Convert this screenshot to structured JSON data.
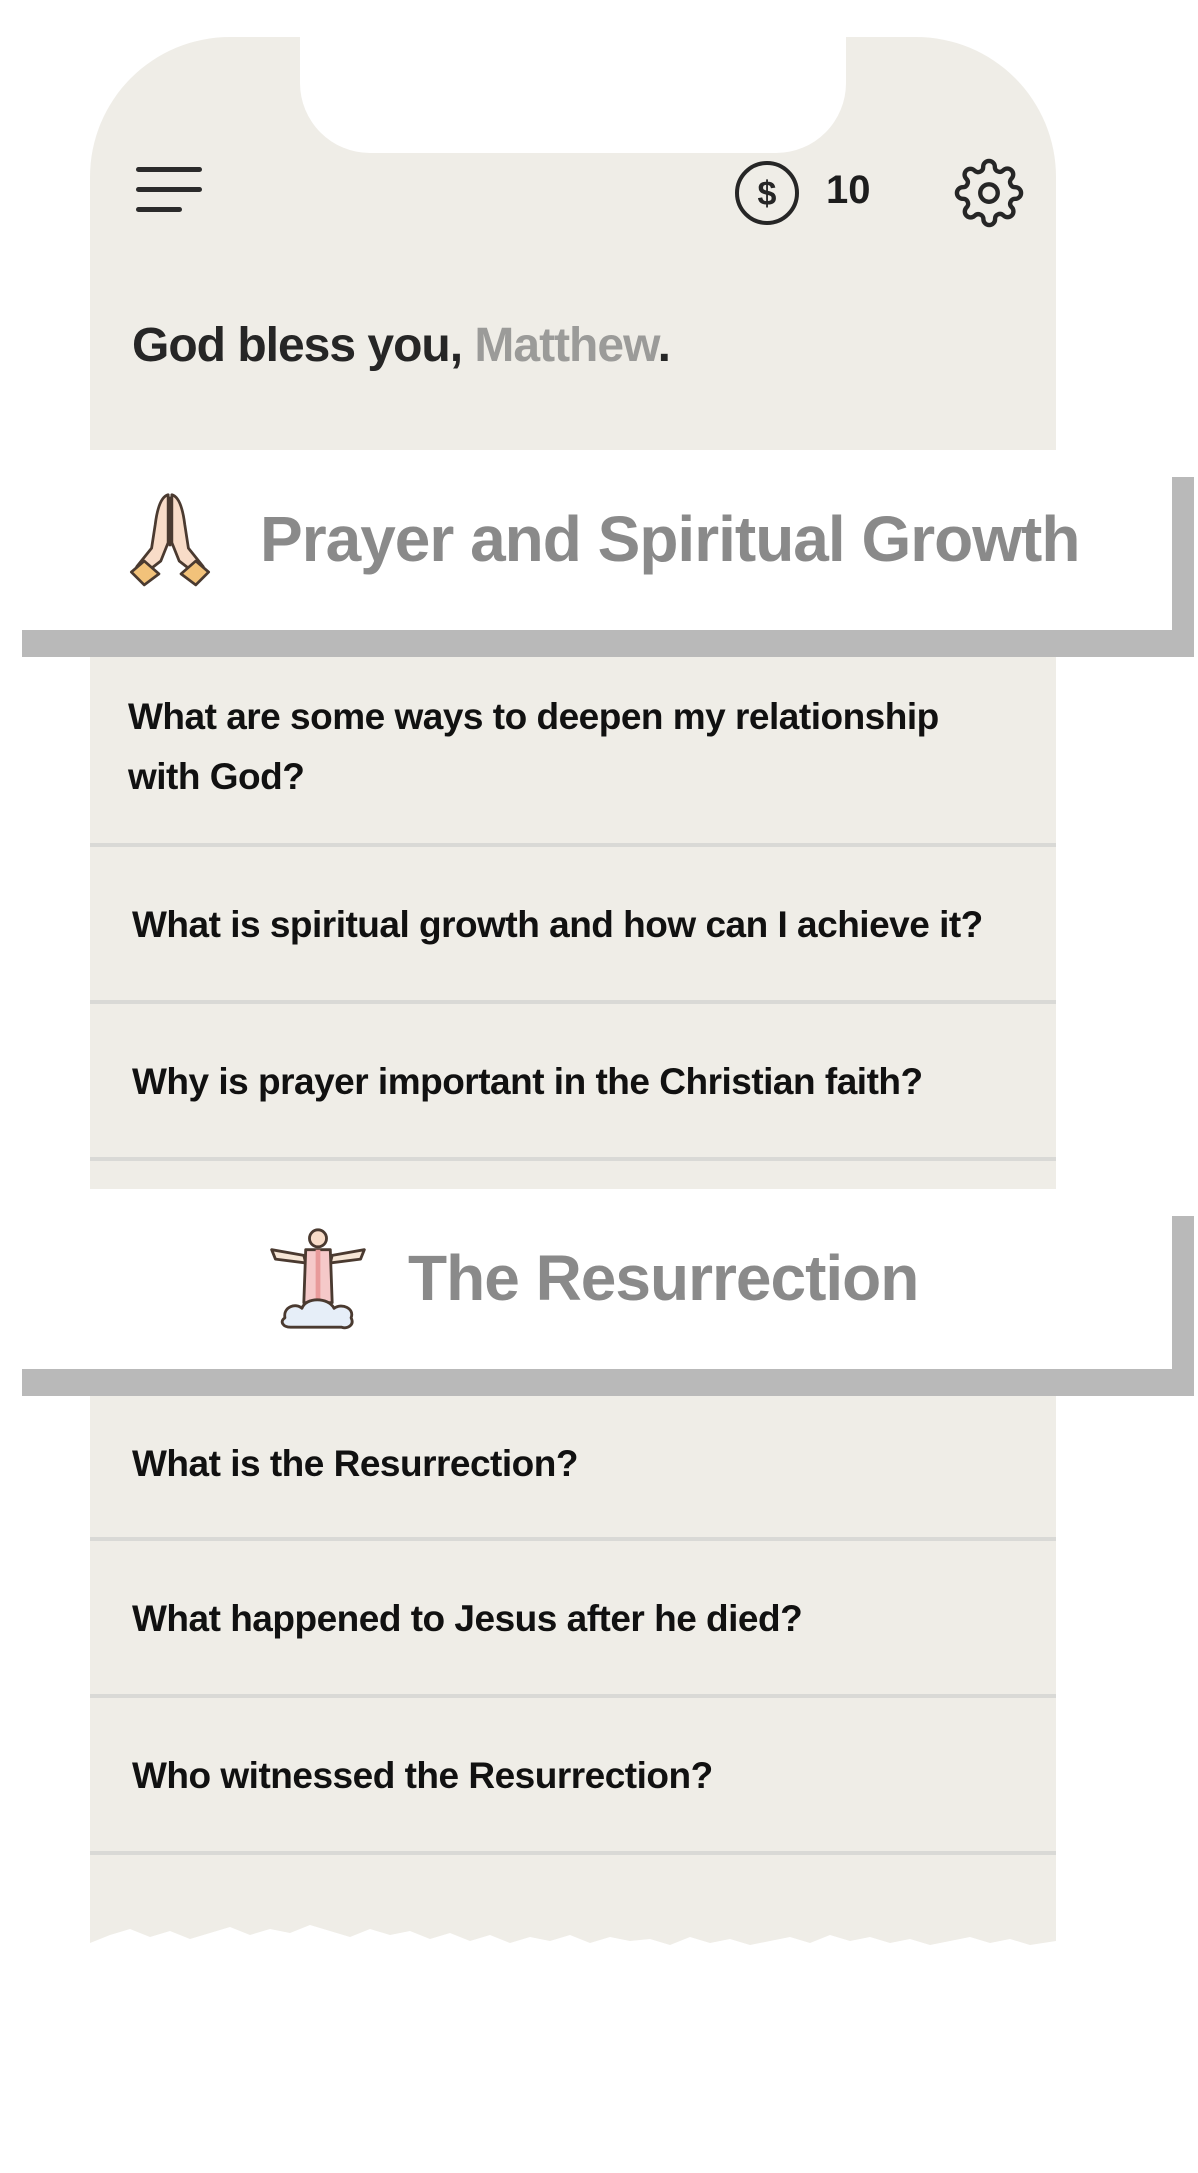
{
  "header": {
    "coin_count": "10",
    "greeting_prefix": "God bless you, ",
    "greeting_name": "Matthew",
    "greeting_suffix": "."
  },
  "icons": {
    "menu": "hamburger-menu-icon",
    "coin": "dollar-coin-icon",
    "settings": "gear-icon",
    "prayer": "praying-hands-icon",
    "resurrection": "christ-statue-icon"
  },
  "sections": [
    {
      "title": "Prayer and Spiritual Growth",
      "questions": [
        "What are some ways to deepen my relationship with God?",
        "What is spiritual growth and how can I achieve it?",
        "Why is prayer important in the Christian faith?"
      ]
    },
    {
      "title": "The Resurrection",
      "questions": [
        "What is the Resurrection?",
        "What happened to Jesus after he died?",
        "Who witnessed the Resurrection?"
      ]
    }
  ],
  "colors": {
    "background": "#efede7",
    "text": "#111111",
    "muted": "#8a8a8a",
    "divider": "#d9d9d6",
    "card": "#ffffff",
    "shadow": "#b9b9b9"
  }
}
